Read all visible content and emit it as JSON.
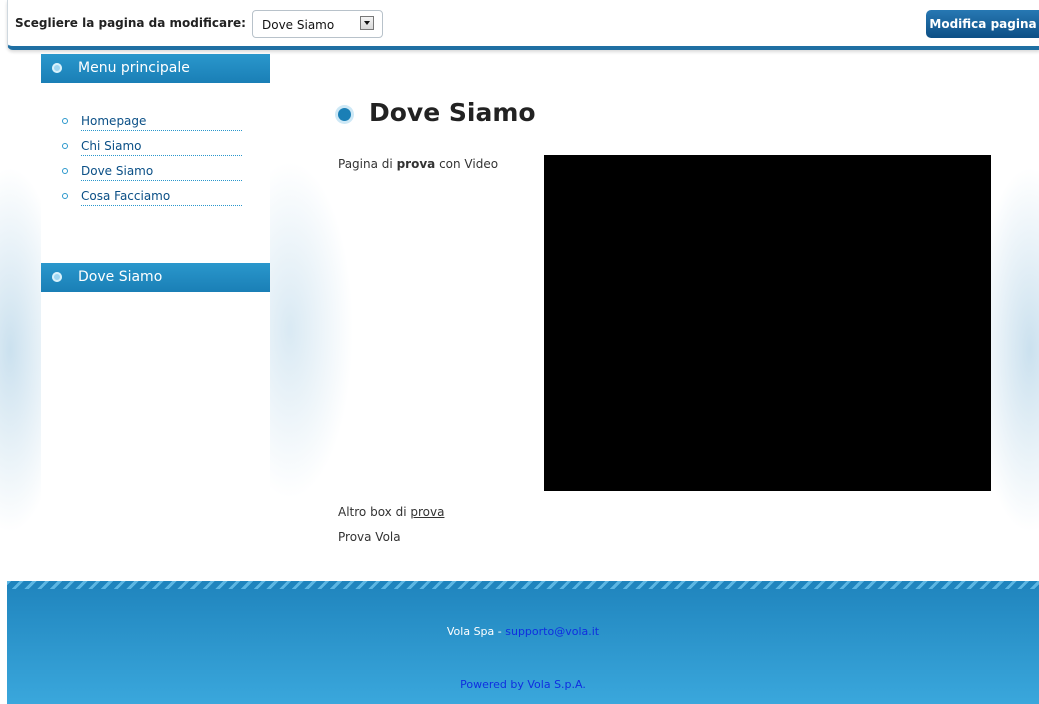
{
  "toolbar": {
    "label": "Scegliere la pagina da modificare:",
    "selected_page": "Dove Siamo",
    "edit_button": "Modifica pagina"
  },
  "sidebar": {
    "main_menu_title": "Menu principale",
    "items": [
      {
        "label": "Homepage"
      },
      {
        "label": "Chi Siamo"
      },
      {
        "label": "Dove Siamo"
      },
      {
        "label": "Cosa Facciamo"
      }
    ],
    "section_title": "Dove Siamo"
  },
  "main": {
    "title": "Dove Siamo",
    "intro_prefix": "Pagina di",
    "intro_bold": "prova",
    "intro_suffix": "con Video",
    "altro_prefix": "Altro box di",
    "altro_link": "prova",
    "prova_text": "Prova Vola"
  },
  "footer": {
    "company": "Vola Spa -",
    "email": "supporto@vola.it",
    "powered": "Powered by Vola S.p.A."
  },
  "colors": {
    "accent": "#1a7fb6",
    "link": "#0a4f86",
    "footer_link": "#0f2ee0"
  }
}
